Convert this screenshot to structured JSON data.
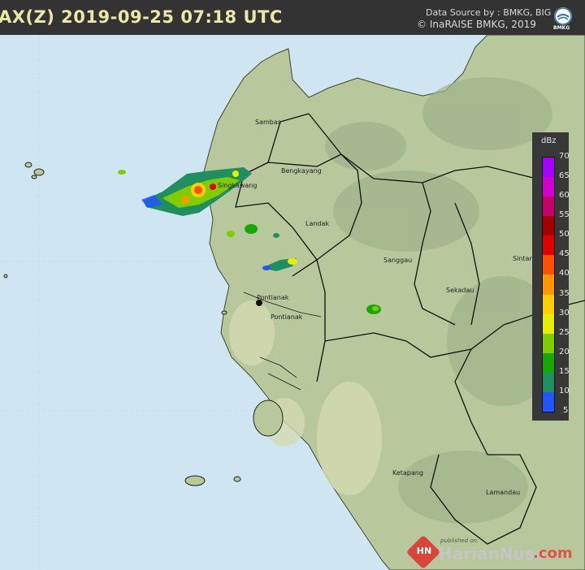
{
  "header": {
    "title": "AX(Z) 2019-09-25 07:18 UTC",
    "source_line1": "Data Source by : BMKG, BIG",
    "source_line2": "© InaRAISE BMKG, 2019",
    "logo_text": "BMKG"
  },
  "places": [
    "Sambas",
    "Bengkayang",
    "Singkawang",
    "Landak",
    "Sanggau",
    "Sintang",
    "Sekadau",
    "Pontianak",
    "Pontianak",
    "Ketapang",
    "Lamandau"
  ],
  "legend": {
    "unit": "dBz",
    "ticks": [
      70,
      65,
      60,
      55,
      50,
      45,
      40,
      35,
      30,
      25,
      20,
      15,
      10,
      5
    ],
    "colors": [
      "#a300ff",
      "#d100d1",
      "#c4006a",
      "#a20000",
      "#e00000",
      "#ff5000",
      "#ff9800",
      "#ffd000",
      "#e8ee00",
      "#7fcc00",
      "#15a800",
      "#1f8f60",
      "#2255ff",
      "#1cc4ff"
    ]
  },
  "colors": {
    "sea": "#cfe6f2",
    "land": "#b6c69a",
    "header_bg": "#333333",
    "title": "#ece6a8"
  },
  "watermark": {
    "published": "published on:",
    "icon": "HN",
    "name": "HarianNusa",
    "domain": ".com"
  }
}
